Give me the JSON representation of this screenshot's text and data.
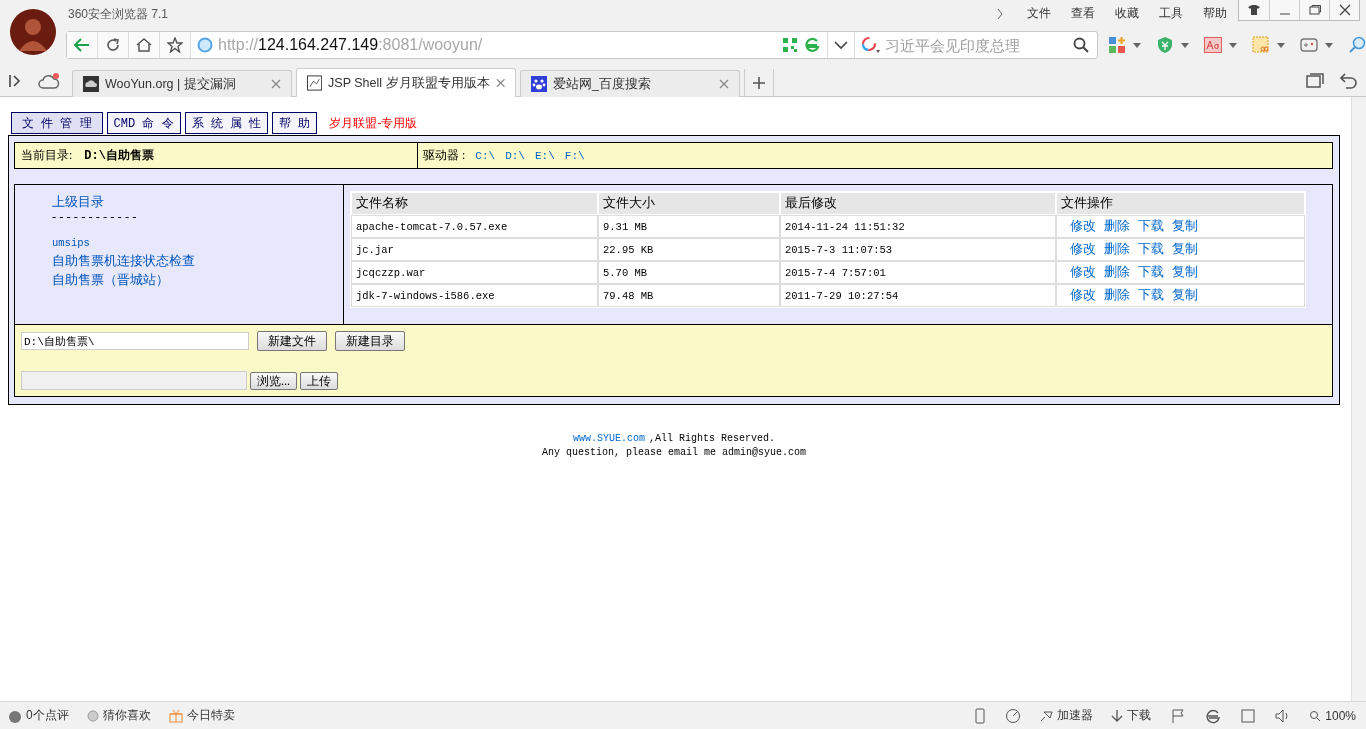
{
  "browser": {
    "title": "360安全浏览器 7.1",
    "menu": [
      "文件",
      "查看",
      "收藏",
      "工具",
      "帮助"
    ],
    "address": {
      "scheme": "http://",
      "host": "124.164.247.149",
      "rest": ":8081/wooyun/"
    },
    "search": {
      "placeholder": "习近平会见印度总理"
    },
    "tabs": [
      {
        "label": "WooYun.org | 提交漏洞",
        "selected": false,
        "kind": "cloud"
      },
      {
        "label": "JSP Shell 岁月联盟专用版本",
        "selected": true,
        "kind": "page"
      },
      {
        "label": "爱站网_百度搜索",
        "selected": false,
        "kind": "paw"
      }
    ]
  },
  "page": {
    "nav": [
      {
        "label": "文 件 管 理",
        "selected": true
      },
      {
        "label": "CMD 命 令",
        "selected": false
      },
      {
        "label": "系 统 属 性",
        "selected": false
      },
      {
        "label": "帮 助",
        "selected": false
      }
    ],
    "edition": "岁月联盟-专用版",
    "current_dir": {
      "label": "当前目录:",
      "value": "D:\\自助售票"
    },
    "drives": {
      "label": "驱动器 :",
      "items": [
        "C:\\",
        "D:\\",
        "E:\\",
        "F:\\"
      ]
    },
    "sidebar": [
      {
        "label": "上级目录",
        "kind": "link"
      },
      {
        "label": "- - - - - - - - - - - -",
        "kind": "divider"
      },
      {
        "label": "umsips",
        "kind": "folder"
      },
      {
        "label": "自助售票机连接状态检查",
        "kind": "link"
      },
      {
        "label": "自助售票（晋城站）",
        "kind": "link"
      }
    ],
    "table": {
      "columns": [
        "文件名称",
        "文件大小",
        "最后修改",
        "文件操作"
      ],
      "rows": [
        {
          "name": "apache-tomcat-7.0.57.exe",
          "size": "9.31 MB",
          "modified": "2014-11-24 11:51:32",
          "actions": [
            "修改",
            "删除",
            "下载",
            "复制"
          ]
        },
        {
          "name": "jc.jar",
          "size": "22.95 KB",
          "modified": "2015-7-3 11:07:53",
          "actions": [
            "修改",
            "删除",
            "下载",
            "复制"
          ]
        },
        {
          "name": "jcqczzp.war",
          "size": "5.70 MB",
          "modified": "2015-7-4 7:57:01",
          "actions": [
            "修改",
            "删除",
            "下载",
            "复制"
          ]
        },
        {
          "name": "jdk-7-windows-i586.exe",
          "size": "79.48 MB",
          "modified": "2011-7-29 10:27:54",
          "actions": [
            "修改",
            "删除",
            "下载",
            "复制"
          ]
        }
      ]
    },
    "path_field": {
      "value": "D:\\自助售票\\"
    },
    "create_buttons": [
      "新建文件",
      "新建目录"
    ],
    "upload": {
      "browse": "浏览...",
      "submit": "上传"
    },
    "footer": {
      "link": "www.SYUE.com",
      "rights": ",All Rights Reserved.",
      "contact": "Any question, please email me admin@syue.com"
    }
  },
  "status_bar": {
    "left": [
      "0个点评",
      "猜你喜欢",
      "今日特卖"
    ],
    "accelerator": "加速器",
    "download": "下载",
    "zoom": "100%"
  }
}
